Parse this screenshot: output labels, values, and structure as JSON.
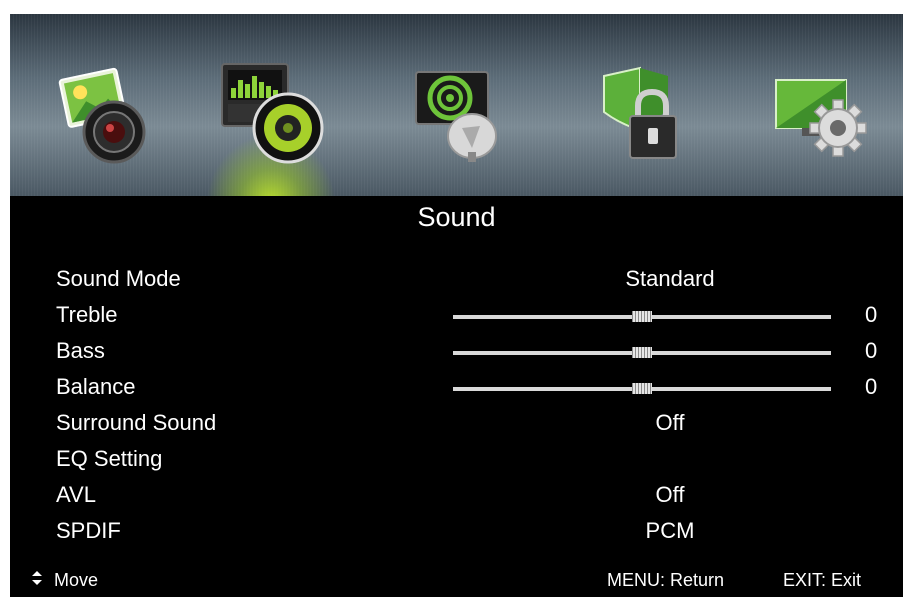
{
  "title": "Sound",
  "icons": [
    "picture-icon",
    "sound-icon",
    "channel-icon",
    "lock-icon",
    "setup-icon"
  ],
  "menu": [
    {
      "label": "Sound Mode",
      "value": "Standard"
    },
    {
      "label": "Treble",
      "slider": 0.5,
      "value": "0"
    },
    {
      "label": "Bass",
      "slider": 0.5,
      "value": "0"
    },
    {
      "label": "Balance",
      "slider": 0.5,
      "value": "0"
    },
    {
      "label": "Surround Sound",
      "value": "Off"
    },
    {
      "label": "EQ Setting",
      "value": ""
    },
    {
      "label": "AVL",
      "value": "Off"
    },
    {
      "label": "SPDIF",
      "value": "PCM"
    }
  ],
  "footer": {
    "move": "Move",
    "menu": "MENU: Return",
    "exit": "EXIT: Exit"
  }
}
